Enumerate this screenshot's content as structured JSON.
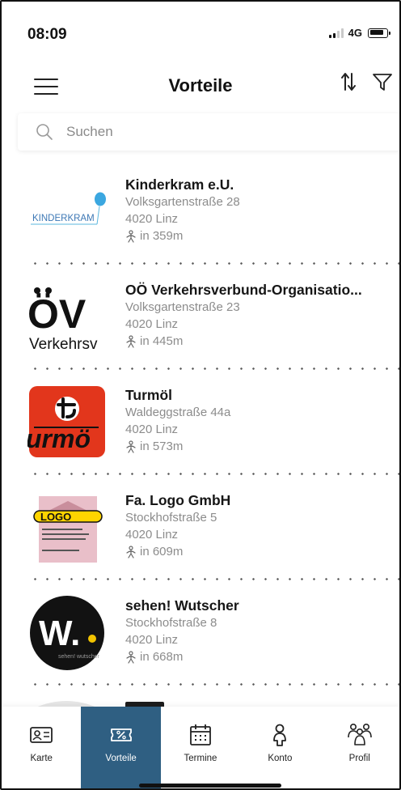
{
  "status_bar": {
    "time": "08:09",
    "network": "4G",
    "signal_bars": 2,
    "battery_level": 0.85
  },
  "header": {
    "title": "Vorteile",
    "menu_icon": "hamburger-icon",
    "sort_icon": "sort-arrows-icon",
    "filter_icon": "filter-funnel-icon"
  },
  "search": {
    "placeholder": "Suchen",
    "value": "",
    "icon": "search-icon"
  },
  "accent_color": "#2f5f82",
  "partners": [
    {
      "name": "Kinderkram e.U.",
      "street": "Volksgartenstraße 28",
      "city": "4020 Linz",
      "distance": "in 359m",
      "logo_text": "KINDERKRAM"
    },
    {
      "name": "OÖ Verkehrsverbund-Organisatio...",
      "street": "Volksgartenstraße 23",
      "city": "4020 Linz",
      "distance": "in 445m",
      "logo_text": "ÖV",
      "logo_subtext": "Verkehrsv"
    },
    {
      "name": "Turmöl",
      "street": "Waldeggstraße 44a",
      "city": "4020 Linz",
      "distance": "in 573m",
      "logo_text": "urmö"
    },
    {
      "name": "Fa. Logo GmbH",
      "street": "Stockhofstraße 5",
      "city": "4020 Linz",
      "distance": "in 609m",
      "logo_text": "LOGO"
    },
    {
      "name": "sehen! Wutscher",
      "street": "Stockhofstraße 8",
      "city": "4020 Linz",
      "distance": "in 668m",
      "logo_text": "W.",
      "logo_subtext": "sehen! wutscher"
    }
  ],
  "bottom_nav": [
    {
      "label": "Karte",
      "icon": "id-card-icon",
      "active": false
    },
    {
      "label": "Vorteile",
      "icon": "coupon-icon",
      "active": true
    },
    {
      "label": "Termine",
      "icon": "calendar-icon",
      "active": false
    },
    {
      "label": "Konto",
      "icon": "person-icon",
      "active": false
    },
    {
      "label": "Profil",
      "icon": "group-icon",
      "active": false
    }
  ]
}
